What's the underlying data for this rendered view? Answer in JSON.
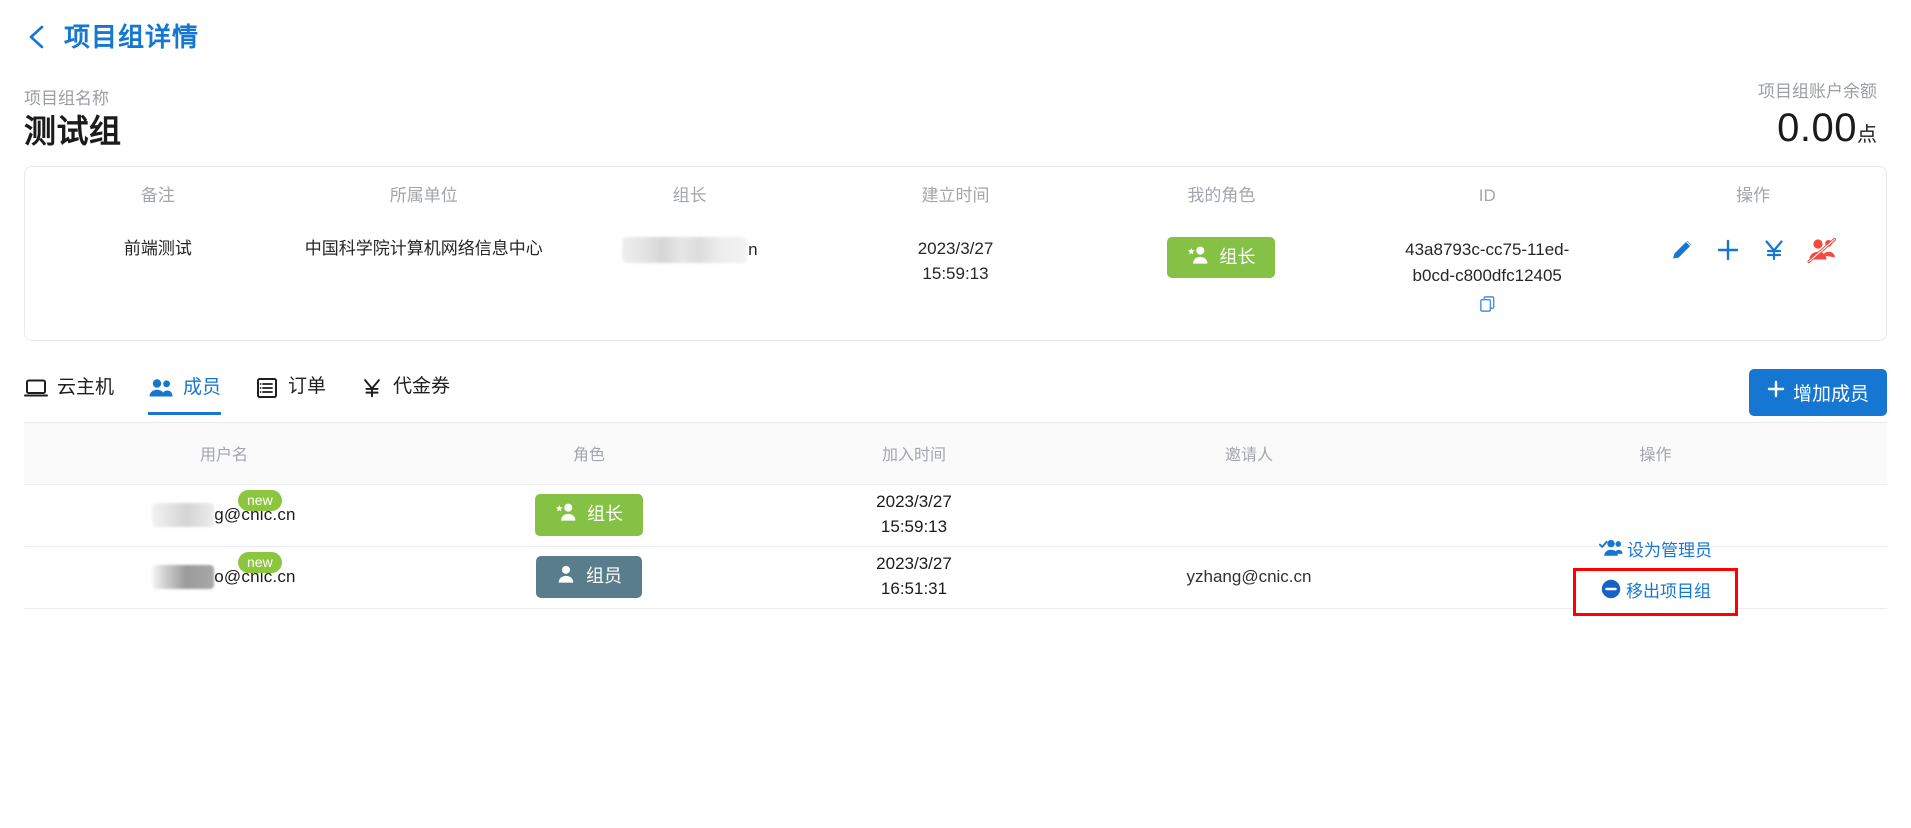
{
  "header": {
    "back_icon": "chevron-left-icon",
    "title": "项目组详情"
  },
  "summary": {
    "name_label": "项目组名称",
    "name_value": "测试组",
    "balance_label": "项目组账户余额",
    "balance_value": "0.00",
    "balance_unit": "点"
  },
  "info_card": {
    "columns": [
      {
        "head": "备注",
        "value": "前端测试"
      },
      {
        "head": "所属单位",
        "value": "中国科学院计算机网络信息中心"
      },
      {
        "head": "组长",
        "value": "n"
      },
      {
        "head": "建立时间",
        "value": "2023/3/27\n15:59:13"
      },
      {
        "head": "我的角色",
        "value": "组长"
      },
      {
        "head": "ID",
        "value": "43a8793c-cc75-11ed-b0cd-c800dfc12405"
      },
      {
        "head": "操作",
        "value": ""
      }
    ],
    "create_date": "2023/3/27",
    "create_time": "15:59:13",
    "my_role_badge": "组长",
    "id_value": "43a8793c-cc75-11ed-b0cd-c800dfc12405",
    "copy_icon": "copy-icon",
    "actions": [
      {
        "name": "edit-icon",
        "color": "#1677d2"
      },
      {
        "name": "plus-icon",
        "color": "#1677d2"
      },
      {
        "name": "yen-icon",
        "color": "#1677d2"
      },
      {
        "name": "disband-group-icon",
        "color": "#f04b3c"
      }
    ]
  },
  "tabs": [
    {
      "label": "云主机",
      "icon": "laptop-icon",
      "active": false
    },
    {
      "label": "成员",
      "icon": "people-icon",
      "active": true
    },
    {
      "label": "订单",
      "icon": "list-icon",
      "active": false
    },
    {
      "label": "代金券",
      "icon": "yen-icon",
      "active": false
    }
  ],
  "add_member_button": {
    "label": "增加成员",
    "icon": "plus-icon"
  },
  "table": {
    "headers": [
      "用户名",
      "角色",
      "加入时间",
      "邀请人",
      "操作"
    ],
    "rows": [
      {
        "username_suffix": "g@cnic.cn",
        "badge": "new",
        "role": "组长",
        "role_type": "leader",
        "join_date": "2023/3/27",
        "join_time": "15:59:13",
        "inviter": "",
        "actions": []
      },
      {
        "username_suffix": "o@cnic.cn",
        "badge": "new",
        "role": "组员",
        "role_type": "member",
        "join_date": "2023/3/27",
        "join_time": "16:51:31",
        "inviter": "yzhang@cnic.cn",
        "actions": [
          {
            "label": "设为管理员",
            "icon": "person-check-icon",
            "highlighted": false
          },
          {
            "label": "移出项目组",
            "icon": "minus-circle-icon",
            "highlighted": true
          }
        ]
      }
    ]
  },
  "colors": {
    "primary": "#1677d2",
    "leader_green": "#84c144",
    "member_slate": "#5a7d8c",
    "danger_red": "#f04b3c",
    "annotation_red": "#ff0000",
    "new_badge_green": "#8cc63f"
  }
}
